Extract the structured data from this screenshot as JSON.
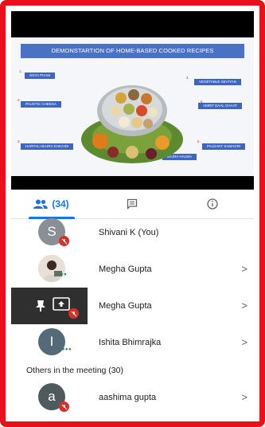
{
  "slide": {
    "title": "DEMONSTARTION OF HOME-BASED COOKED RECIPES",
    "labels": [
      "SOYA PHAM",
      "PAUSTIC CHEESA",
      "HARYALI BAJRA KHICHDI",
      "VEGETABLE SEVIYAN",
      "AMRIT DAAL CHAAT",
      "PALDAKT SAMAGRI",
      "BAJRA HALWA"
    ],
    "numbers": [
      "1.",
      "2.",
      "3.",
      "4.",
      "5.",
      "6.",
      "7."
    ]
  },
  "tabs": {
    "people_count": "(34)",
    "chat_icon": "chat-icon",
    "info_icon": "info-icon"
  },
  "participants": [
    {
      "name": "Shivani K (You)",
      "avatar_letter": "S",
      "avatar_color": "#8a8f95",
      "muted": true
    },
    {
      "name": "Megha Gupta",
      "avatar_letter": "",
      "avatar_color": "#c9c2b8",
      "speaking": true
    },
    {
      "name": "Megha Gupta",
      "presenting": true
    },
    {
      "name": "Ishita Bhimrajka",
      "avatar_letter": "I",
      "avatar_color": "#546a78",
      "speaking": true
    }
  ],
  "others_heading": "Others in the meeting (30)",
  "others": [
    {
      "name": "aashima gupta",
      "avatar_letter": "a",
      "avatar_color": "#4e5a5c",
      "muted": true
    }
  ],
  "colors": {
    "frame": "#e8111b",
    "accent": "#1a73e8",
    "muted_red": "#d93025",
    "speaking_green": "#1e8e3e"
  }
}
